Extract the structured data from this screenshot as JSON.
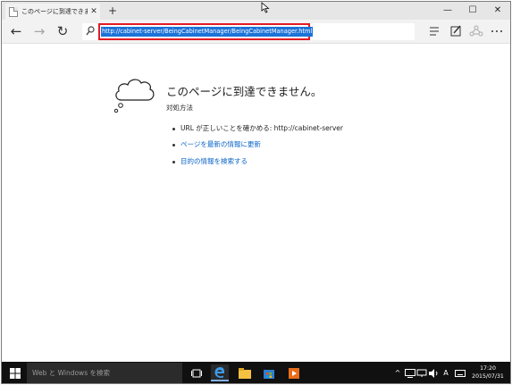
{
  "browser": {
    "tab_title": "このページに到達できません",
    "tab_close": "✕",
    "new_tab": "+",
    "window_controls": {
      "minimize": "—",
      "maximize": "☐",
      "close": "✕"
    }
  },
  "navbar": {
    "back": "←",
    "forward": "→",
    "refresh": "↻",
    "url": "http://cabinet-server/BeingCabinetManager/BeingCabinetManager.html"
  },
  "page": {
    "title": "このページに到達できません。",
    "subtitle": "対処方法",
    "suggestions": [
      {
        "text": "URL が正しいことを確かめる: http://cabinet-server",
        "is_link": false
      },
      {
        "text": "ページを最新の情報に更新",
        "is_link": true
      },
      {
        "text": "目的の情報を検索する",
        "is_link": true
      }
    ]
  },
  "taskbar": {
    "search_placeholder": "Web と Windows を検索",
    "tray_chevron": "^",
    "ime": "A",
    "time": "17:20",
    "date": "2015/07/31"
  },
  "colors": {
    "accent": "#1c73d8",
    "highlight_border": "#e21b23",
    "link": "#0a64c8",
    "taskbar": "#101010"
  }
}
